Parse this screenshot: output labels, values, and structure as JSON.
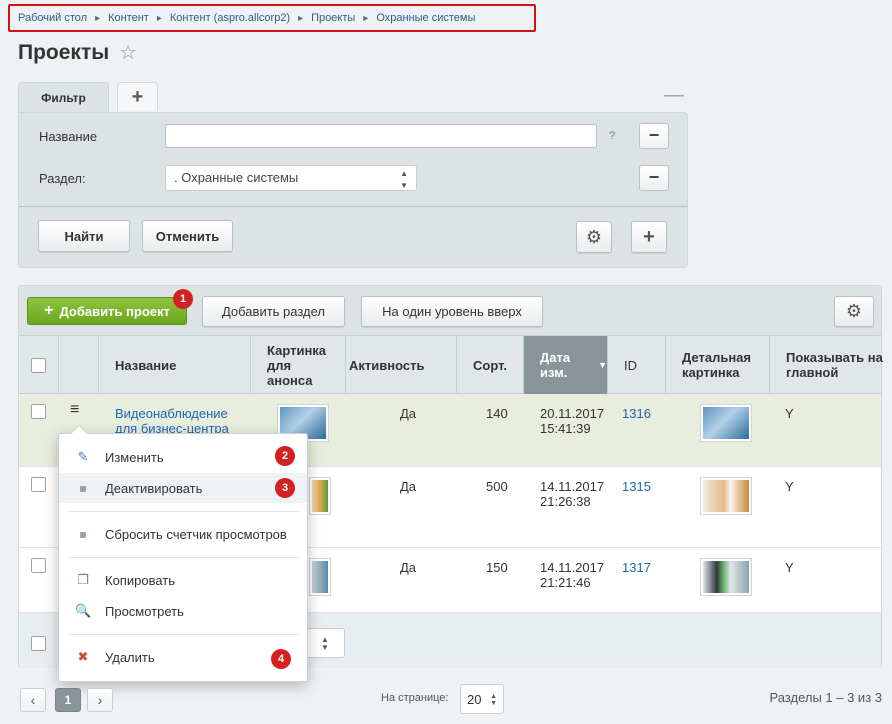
{
  "breadcrumb": [
    "Рабочий стол",
    "Контент",
    "Контент (aspro.allcorp2)",
    "Проекты",
    "Охранные системы"
  ],
  "page_title": "Проекты",
  "filter": {
    "tab_label": "Фильтр",
    "name_label": "Название",
    "name_value": "",
    "help": "?",
    "section_label": "Раздел:",
    "section_value": ". Охранные системы",
    "find_button": "Найти",
    "cancel_button": "Отменить"
  },
  "toolbar": {
    "add_project": "Добавить проект",
    "add_section": "Добавить раздел",
    "level_up": "На один уровень вверх"
  },
  "badges": [
    "1",
    "2",
    "3",
    "4"
  ],
  "columns": {
    "name": "Название",
    "preview_pic": "Картинка для анонса",
    "active": "Активность",
    "sort": "Сорт.",
    "date": "Дата изм.",
    "id": "ID",
    "detail_pic": "Детальная картинка",
    "show_main": "Показывать на главной"
  },
  "rows": [
    {
      "name": "Видеонаблюдение для бизнес-центра",
      "active": "Да",
      "sort": "140",
      "date": "20.11.2017",
      "time": "15:41:39",
      "id": "1316",
      "show_main": "Y"
    },
    {
      "name": "",
      "active": "Да",
      "sort": "500",
      "date": "14.11.2017",
      "time": "21:26:38",
      "id": "1315",
      "show_main": "Y"
    },
    {
      "name": "",
      "active": "Да",
      "sort": "150",
      "date": "14.11.2017",
      "time": "21:21:46",
      "id": "1317",
      "show_main": "Y"
    }
  ],
  "context_menu": {
    "edit": "Изменить",
    "deactivate": "Деактивировать",
    "reset_views": "Сбросить счетчик просмотров",
    "copy": "Копировать",
    "view": "Просмотреть",
    "delete": "Удалить"
  },
  "pager": {
    "current_page": "1",
    "per_page_label": "На странице:",
    "per_page_value": "20",
    "summary": "Разделы 1 – 3 из 3"
  },
  "colors": {
    "accent_green": "#7bb42a",
    "badge_red": "#d32122",
    "highlight_red_border": "#d0131b",
    "selected_row": "#e8eddd"
  }
}
